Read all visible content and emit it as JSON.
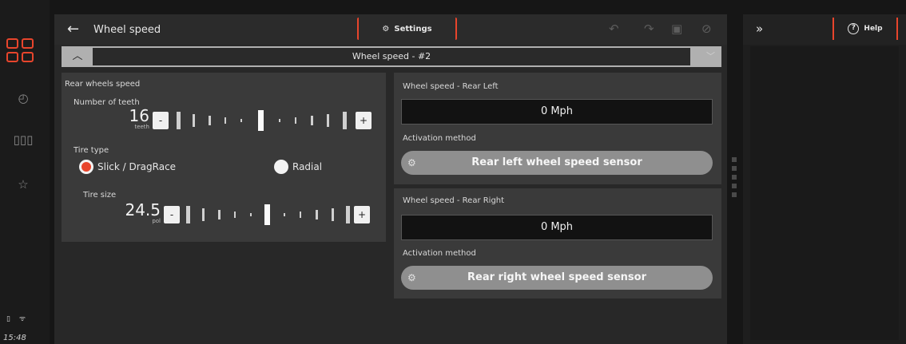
{
  "sidebar": {
    "status_icons": "▯ ᯤ",
    "clock": "15:48"
  },
  "header": {
    "title": "Wheel speed",
    "settings_label": "Settings"
  },
  "section": {
    "title": "Wheel speed - #2"
  },
  "rear_wheels": {
    "heading": "Rear wheels speed",
    "teeth_label": "Number of teeth",
    "teeth_value": "16",
    "teeth_unit": "teeth",
    "minus": "-",
    "plus": "+",
    "tire_type_label": "Tire type",
    "tire_type_options": [
      "Slick / DragRace",
      "Radial"
    ],
    "tire_type_selected": "Slick / DragRace",
    "tire_size_label": "Tire size",
    "tire_size_value": "24.5",
    "tire_size_unit": "pol"
  },
  "rear_left": {
    "heading": "Wheel speed - Rear Left",
    "value": "0 Mph",
    "activation_label": "Activation method",
    "sensor_button": "Rear left wheel speed sensor"
  },
  "rear_right": {
    "heading": "Wheel speed - Rear Right",
    "value": "0 Mph",
    "activation_label": "Activation method",
    "sensor_button": "Rear right wheel speed sensor"
  },
  "right_panel": {
    "help_label": "Help"
  },
  "colors": {
    "accent": "#e8452c",
    "panel": "#282828",
    "card": "#3a3a3a",
    "sensor_button": "#8f8f8f"
  }
}
